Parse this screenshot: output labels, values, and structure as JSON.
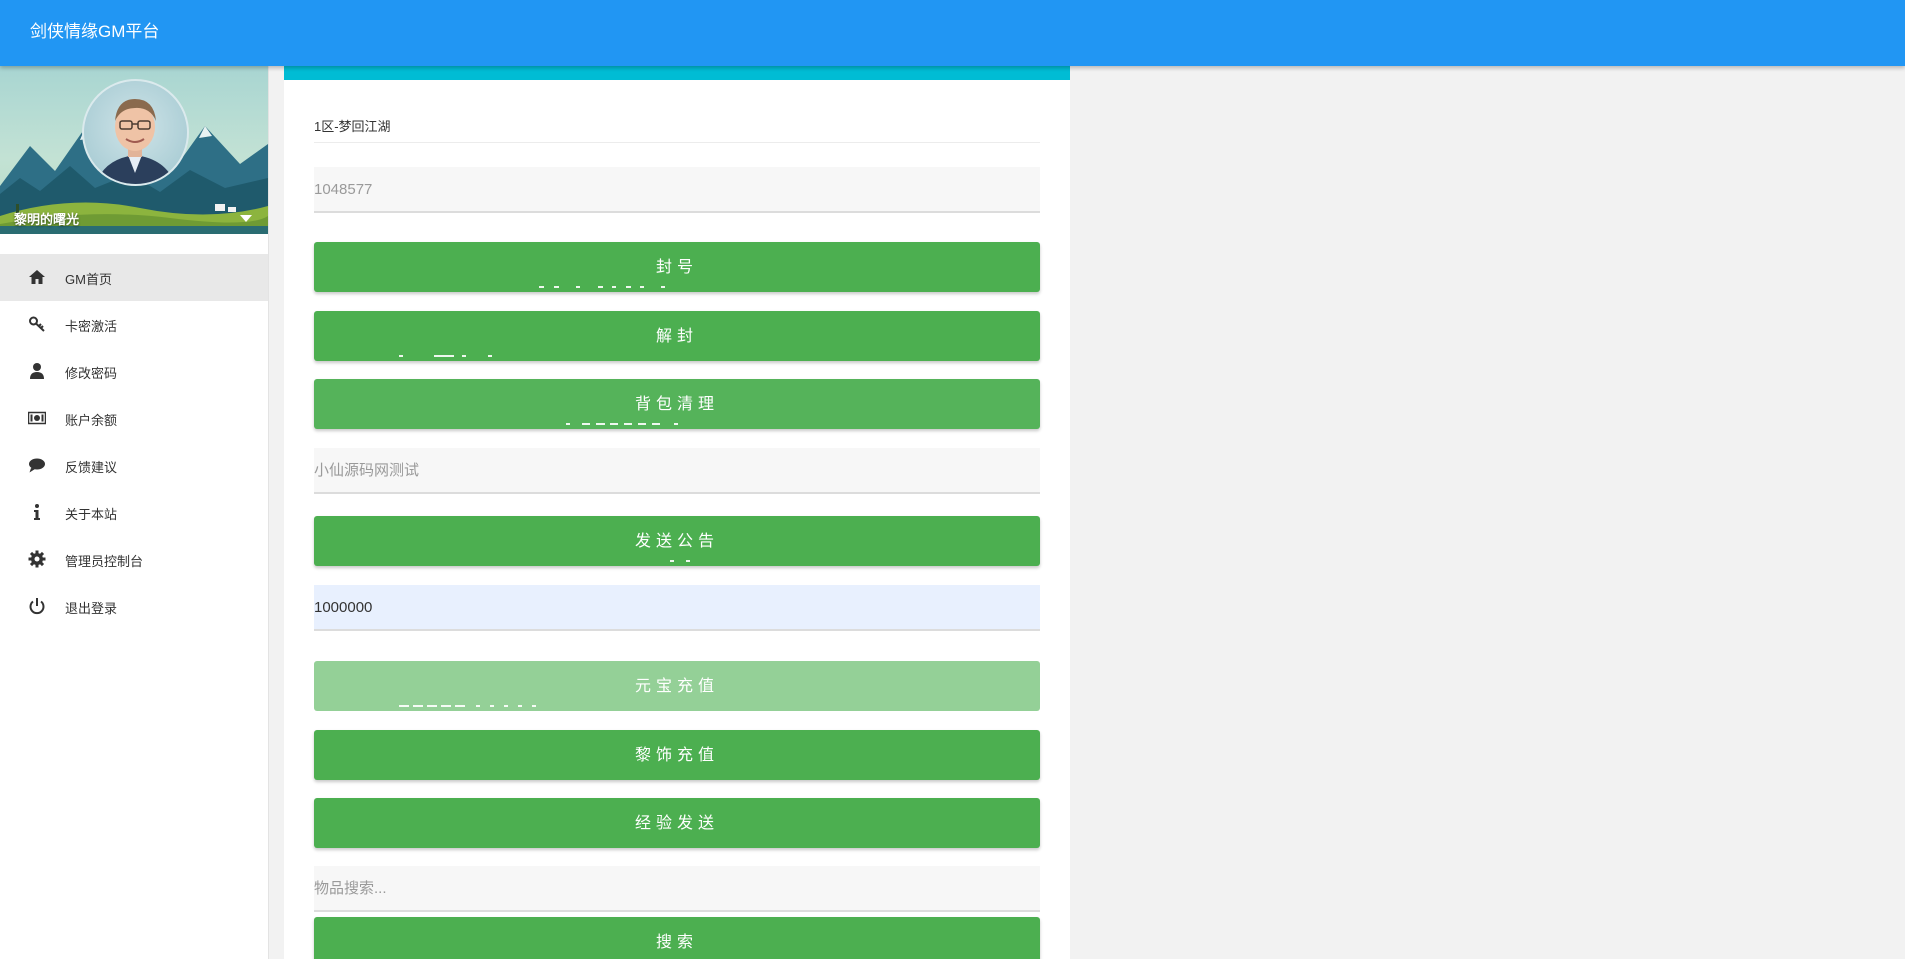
{
  "app": {
    "title": "剑侠情缘GM平台"
  },
  "user": {
    "name": "黎明的曙光"
  },
  "sidebar": {
    "items": [
      {
        "label": "GM首页",
        "icon": "home-icon",
        "active": true
      },
      {
        "label": "卡密激活",
        "icon": "key-icon"
      },
      {
        "label": "修改密码",
        "icon": "user-icon"
      },
      {
        "label": "账户余额",
        "icon": "money-icon"
      },
      {
        "label": "反馈建议",
        "icon": "comment-icon"
      },
      {
        "label": "关于本站",
        "icon": "info-icon"
      },
      {
        "label": "管理员控制台",
        "icon": "gear-icon"
      },
      {
        "label": "退出登录",
        "icon": "power-icon"
      }
    ]
  },
  "form": {
    "server": "1区-梦回江湖",
    "role_id_placeholder": "1048577",
    "ban_label": "封号",
    "unban_label": "解封",
    "clear_bag_label": "背包清理",
    "notice_placeholder": "小仙源码网测试",
    "send_notice_label": "发送公告",
    "amount_value": "1000000",
    "yuanbao_label": "元宝充值",
    "lishi_label": "黎饰充值",
    "exp_label": "经验发送",
    "item_search_placeholder": "物品搜索...",
    "search_label": "搜索"
  },
  "colors": {
    "appbar": "#2196f3",
    "card_accent": "#00bcd4",
    "button": "#4caf50",
    "button_disabled": "#94d097",
    "active_nav": "#e8e8e8"
  }
}
